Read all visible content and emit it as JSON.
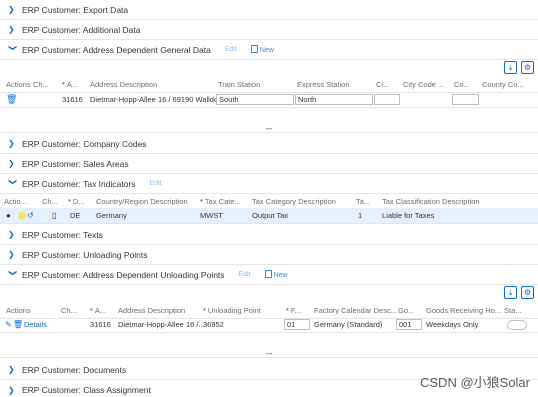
{
  "sections": {
    "export_data": "ERP Customer: Export Data",
    "additional_data": "ERP Customer: Additional Data",
    "addr_general": "ERP Customer: Address Dependent General Data",
    "company_codes": "ERP Customer: Company Codes",
    "sales_areas": "ERP Customer: Sales Areas",
    "tax_indicators": "ERP Customer: Tax Indicators",
    "texts": "ERP Customer: Texts",
    "unloading_points": "ERP Customer: Unloading Points",
    "addr_unloading": "ERP Customer: Address Dependent Unloading Points",
    "documents": "ERP Customer: Documents",
    "class_assignment": "ERP Customer: Class Assignment"
  },
  "actions": {
    "edit": "Edit",
    "new": "New"
  },
  "addr_general_table": {
    "headers": [
      "Actions",
      "Ch...",
      "A...",
      "Address Description",
      "Train Station",
      "Express Station",
      "Ci...",
      "City Code ...",
      "Co...",
      "County Co..."
    ],
    "row": {
      "a": "31616",
      "address": "Dietmar-Hopp-Allee 16 / 69190 Walldorf",
      "train": "South",
      "express": "North"
    }
  },
  "tax_table": {
    "headers": [
      "Actio...",
      "Ch...",
      "D...",
      "Country/Region Description",
      "Tax Cate...",
      "Tax Category Description",
      "Ta...",
      "Tax Classification Description"
    ],
    "row": {
      "d": "DE",
      "country": "Germany",
      "tax_cat": "MWST",
      "tax_desc": "Output Tax",
      "ta": "1",
      "class_desc": "Liable for Taxes"
    }
  },
  "unloading_table": {
    "headers": [
      "Actions",
      "Ch...",
      "A...",
      "Address Description",
      "Unloading Point",
      "F...",
      "Factory Calendar Desc...",
      "Go...",
      "Goods Receiving Ho...",
      "Sta..."
    ],
    "row": {
      "details": "Details",
      "a": "31616",
      "address": "Dietmar-Hopp-Allee 16 /...",
      "unloading": "36952",
      "f": "01",
      "factory": "Germany (Standard)",
      "go": "001",
      "goods": "Weekdays Only"
    }
  },
  "watermark": "CSDN @小狼Solar",
  "colors": {
    "accent": "#0a6ed1",
    "required": "#bb0000",
    "selected_row": "#e5f0fa"
  }
}
